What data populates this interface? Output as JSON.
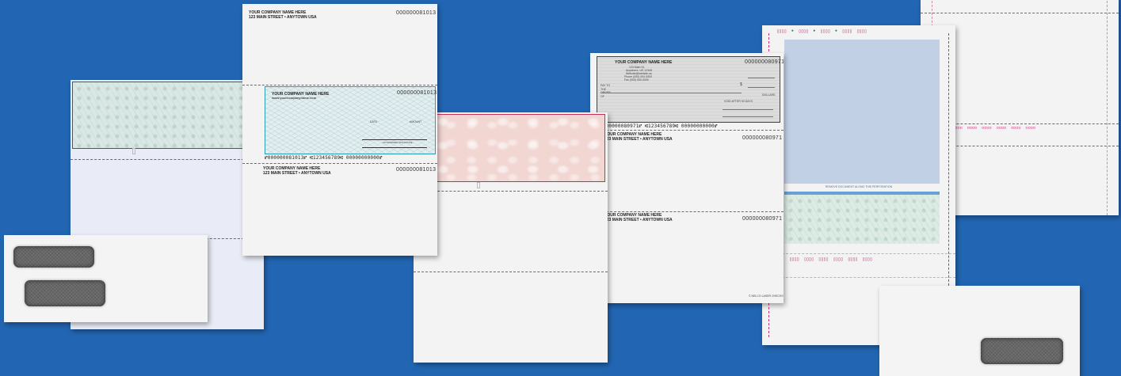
{
  "company_name": "YOUR COMPANY NAME HERE",
  "company_address": "123 MAIN STREET • ANYTOWN USA",
  "website": "www.yourcompanyname.com",
  "check_a": {
    "number": "000000081013",
    "micr": "⑈000000081013⑈ ⑆123456789⑆ 00000000000⑈",
    "date_label": "DATE",
    "amount_label": "AMOUNT",
    "sig_label": "AUTHORIZED SIGNATURE"
  },
  "check_b": {
    "number": "000000080971",
    "micr": "⑈000000080971⑈ ⑆123456789⑆ 00000000000⑈",
    "address_lines": [
      "123 Main St.",
      "Anywhere, US 12345",
      "Website@website.us",
      "Phone (000) 000-0000",
      "Fax (000) 000-0000"
    ],
    "pay_to_label": "PAY TO THE ORDER OF",
    "dollars_label": "DOLLARS",
    "void_label": "VOID AFTER 90 DAYS",
    "sig_label": "AUTHORIZED SIGNATURE",
    "footer_mark": "© NELCO  LASER CHECKS"
  },
  "perforated_doc": {
    "perforation_text": "REMOVE DOCUMENT ALONG THIS PERFORATION"
  },
  "colors": {
    "background": "#2266b3",
    "envelope_window": "#5f5f5f",
    "check_pink_border": "#c2305a",
    "check_blue_border": "#1f5fa8",
    "pin_feed_mark": "#c5307a"
  },
  "icons": [
    "envelope-window",
    "padlock-icon"
  ]
}
